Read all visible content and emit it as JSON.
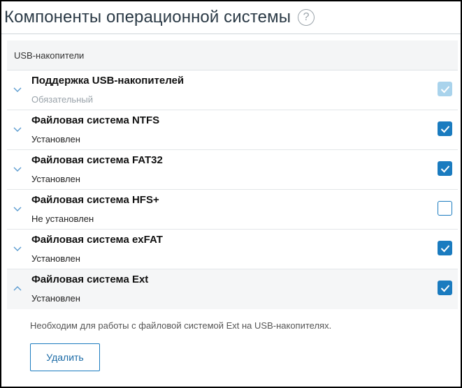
{
  "header": {
    "title": "Компоненты операционной системы",
    "help_icon": "?"
  },
  "section": {
    "label": "USB-накопители"
  },
  "components": [
    {
      "name": "Поддержка USB-накопителей",
      "status": "Обязательный",
      "checked": true,
      "disabled": true,
      "expanded": false
    },
    {
      "name": "Файловая система NTFS",
      "status": "Установлен",
      "checked": true,
      "disabled": false,
      "expanded": false
    },
    {
      "name": "Файловая система FAT32",
      "status": "Установлен",
      "checked": true,
      "disabled": false,
      "expanded": false
    },
    {
      "name": "Файловая система HFS+",
      "status": "Не установлен",
      "checked": false,
      "disabled": false,
      "expanded": false
    },
    {
      "name": "Файловая система exFAT",
      "status": "Установлен",
      "checked": true,
      "disabled": false,
      "expanded": false
    },
    {
      "name": "Файловая система Ext",
      "status": "Установлен",
      "checked": true,
      "disabled": false,
      "expanded": true,
      "description": "Необходим для работы с файловой системой Ext на USB-накопителях.",
      "action_label": "Удалить"
    }
  ],
  "colors": {
    "accent": "#1a7bbf",
    "accent_disabled": "#a9d3ec",
    "expanded_row_bg": "#f5f6f7",
    "section_bg": "#f4f5f6"
  }
}
